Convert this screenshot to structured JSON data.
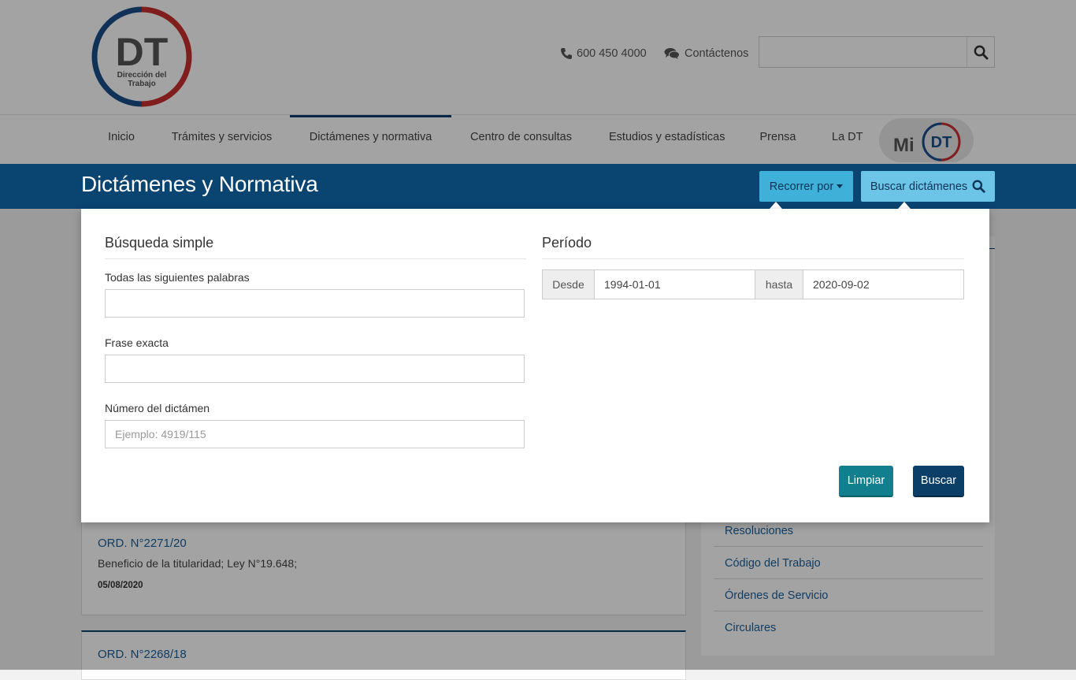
{
  "header": {
    "logo_text": "DT",
    "logo_subtitle_1": "Dirección del",
    "logo_subtitle_2": "Trabajo",
    "phone": "600 450 4000",
    "contact": "Contáctenos",
    "search_placeholder": ""
  },
  "nav": {
    "items": [
      {
        "label": "Inicio"
      },
      {
        "label": "Trámites y servicios"
      },
      {
        "label": "Dictámenes y normativa",
        "active": true
      },
      {
        "label": "Centro de consultas"
      },
      {
        "label": "Estudios y estadísticas"
      },
      {
        "label": "Prensa"
      },
      {
        "label": "La DT"
      }
    ],
    "mi_dt_prefix": "Mi",
    "mi_dt_logo": "DT"
  },
  "section": {
    "title": "Dictámenes y Normativa",
    "recorrer_label": "Recorrer por",
    "buscar_dictamenes_label": "Buscar dictámenes"
  },
  "search_form": {
    "simple_title": "Búsqueda simple",
    "all_words_label": "Todas las siguientes palabras",
    "all_words_value": "",
    "exact_phrase_label": "Frase exacta",
    "exact_phrase_value": "",
    "number_label": "Número del dictámen",
    "number_placeholder": "Ejemplo: 4919/115",
    "period_title": "Período",
    "from_label": "Desde",
    "from_value": "1994-01-01",
    "to_label": "hasta",
    "to_value": "2020-09-02",
    "clear_label": "Limpiar",
    "search_label": "Buscar"
  },
  "results": [
    {
      "code": "ORD. N°2271/20",
      "description": "Beneficio de la titularidad; Ley N°19.648;",
      "date": "05/08/2020"
    },
    {
      "code": "ORD. N°2268/18"
    }
  ],
  "sidebar": {
    "links": [
      {
        "label": "Resoluciones"
      },
      {
        "label": "Código del Trabajo"
      },
      {
        "label": "Órdenes de Servicio"
      },
      {
        "label": "Circulares"
      }
    ]
  },
  "colors": {
    "primary_blue": "#0a4470",
    "accent_cyan": "#3fb1d9",
    "teal_button": "#127f8e",
    "logo_blue": "#1b4f8a",
    "logo_red": "#c8302f"
  },
  "icons": [
    "phone-icon",
    "chat-icon",
    "search-icon",
    "caret-down-icon"
  ]
}
